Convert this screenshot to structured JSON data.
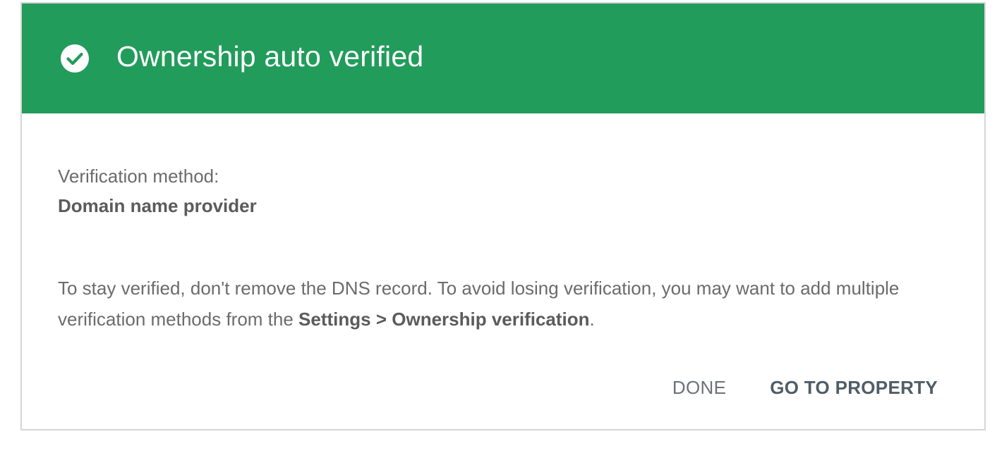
{
  "dialog": {
    "title": "Ownership auto verified",
    "header_color": "#219c5b",
    "status_icon": "check-circle-icon",
    "method_label": "Verification method:",
    "method_value": "Domain name provider",
    "note_text": "To stay verified, don't remove the DNS record. To avoid losing verification, you may want to add multiple verification methods from the ",
    "note_link": "Settings > Ownership verification",
    "note_end": ".",
    "done_label": "DONE",
    "go_to_property_label": "GO TO PROPERTY"
  }
}
